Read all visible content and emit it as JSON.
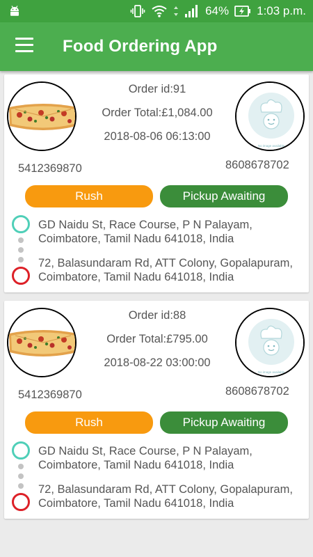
{
  "status_bar": {
    "battery": "64%",
    "time": "1:03 p.m."
  },
  "app_bar": {
    "title": "Food Ordering App"
  },
  "orders": [
    {
      "order_id": "Order id:91",
      "order_total": "Order Total:£1,084.00",
      "datetime": "2018-08-06 06:13:00",
      "customer_phone": "5412369870",
      "restaurant_phone": "8608678702",
      "priority_label": "Rush",
      "status_label": "Pickup Awaiting",
      "pickup_address": "GD Naidu St, Race Course, P N Palayam, Coimbatore, Tamil Nadu 641018, India",
      "drop_address": "72, Balasundaram Rd, ATT Colony, Gopalapuram, Coimbatore, Tamil Nadu 641018, India",
      "placeholder_text": "No image available"
    },
    {
      "order_id": "Order id:88",
      "order_total": "Order Total:£795.00",
      "datetime": "2018-08-22 03:00:00",
      "customer_phone": "5412369870",
      "restaurant_phone": "8608678702",
      "priority_label": "Rush",
      "status_label": "Pickup Awaiting",
      "pickup_address": "GD Naidu St, Race Course, P N Palayam, Coimbatore, Tamil Nadu 641018, India",
      "drop_address": "72, Balasundaram Rd, ATT Colony, Gopalapuram, Coimbatore, Tamil Nadu 641018, India",
      "placeholder_text": "No image available"
    }
  ],
  "colors": {
    "app_bar": "#4cae4f",
    "status_bar": "#3fa23f",
    "rush_button": "#f89a0f",
    "status_button": "#3b8d3a",
    "pickup_marker": "#4fcfb8",
    "drop_marker": "#dd2027"
  },
  "icons": [
    "android-icon",
    "vibrate-icon",
    "wifi-icon",
    "signal-icon",
    "battery-charging-icon",
    "menu-icon",
    "pizza-image",
    "chef-placeholder-icon"
  ]
}
